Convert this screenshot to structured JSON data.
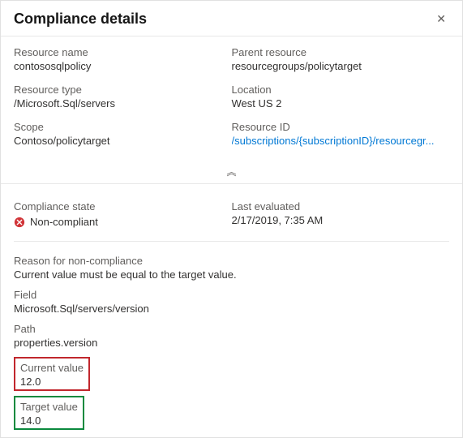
{
  "header": {
    "title": "Compliance details"
  },
  "details": {
    "resourceName": {
      "label": "Resource name",
      "value": "contososqlpolicy"
    },
    "parentResource": {
      "label": "Parent resource",
      "value": "resourcegroups/policytarget"
    },
    "resourceType": {
      "label": "Resource type",
      "value": "/Microsoft.Sql/servers"
    },
    "location": {
      "label": "Location",
      "value": "West US 2"
    },
    "scope": {
      "label": "Scope",
      "value": "Contoso/policytarget"
    },
    "resourceId": {
      "label": "Resource ID",
      "value": "/subscriptions/{subscriptionID}/resourcegr..."
    }
  },
  "status": {
    "complianceState": {
      "label": "Compliance state",
      "value": "Non-compliant",
      "icon": "error-icon"
    },
    "lastEvaluated": {
      "label": "Last evaluated",
      "value": "2/17/2019, 7:35 AM"
    }
  },
  "reason": {
    "title": "Reason for non-compliance",
    "message": "Current value must be equal to the target value.",
    "fieldLabel": "Field",
    "fieldValue": "Microsoft.Sql/servers/version",
    "pathLabel": "Path",
    "pathValue": "properties.version",
    "currentLabel": "Current value",
    "currentValue": "12.0",
    "targetLabel": "Target value",
    "targetValue": "14.0"
  },
  "icons": {
    "collapse": "︽"
  }
}
